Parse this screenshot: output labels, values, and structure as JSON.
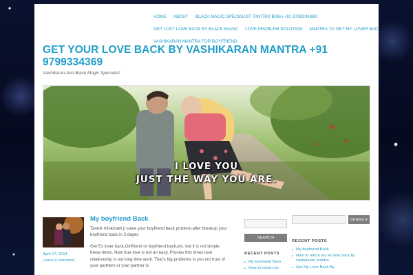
{
  "nav": {
    "row1": [
      "HOME",
      "ABOUT",
      "BLACK MAGIC SPECIALIST TANTRIK BABA +91 9799334369"
    ],
    "row2": [
      "GET LOST LOVE BACK BY BLACK MAGIC",
      "LOVE PROBLEM SOLUTION",
      "MANTRA TO GET MY LOVER BACK"
    ],
    "row3": [
      "VASHIKARAN MANTRA FOR BOYFRIEND"
    ]
  },
  "site": {
    "title": "GET YOUR LOVE BACK BY VASHIKARAN MANTRA +91 9799334369",
    "tagline": "Vashikaran And Black Magic Specialist"
  },
  "hero": {
    "line1": "I LOVE YOU",
    "line2": "JUST THE WAY YOU ARE."
  },
  "post": {
    "title": "My boyfriend Back",
    "date": "April 17, 2014",
    "comment_link": "Leave a comment",
    "paragraphs": [
      "Tantrik trilokinath ji solve your boyfriend back problem.after breakup your boyfriend back in 3 dayes",
      "Get Ex lover back,Girlfriend or boyfriend back,etc. but it is not simple these times. Now true love is not an easy. Proxies this times love relationship is not long time work. That's big problems is you not trust of your partners or your partner is"
    ]
  },
  "sidebar1": {
    "search_button": "SEARCH",
    "recent_heading": "RECENT POSTS",
    "recent": [
      "My boyfriend Back",
      "How to return my"
    ]
  },
  "sidebar2": {
    "search_button": "SEARCH",
    "recent_heading": "RECENT POSTS",
    "recent": [
      "My boyfriend Back",
      "How to return my ex love back by vashikaran mantra",
      "Get My Love Back By"
    ]
  },
  "colors": {
    "accent": "#1f9dc8",
    "button": "#7d7d7d"
  }
}
